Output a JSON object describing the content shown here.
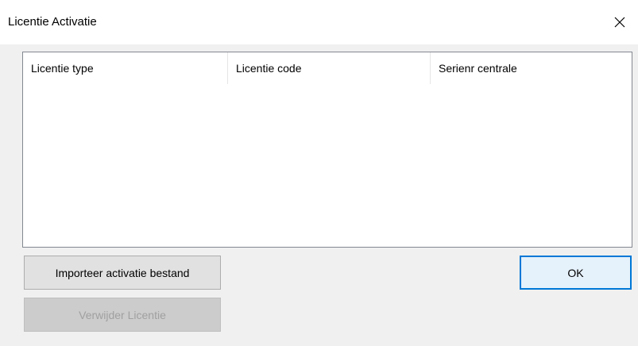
{
  "window": {
    "title": "Licentie Activatie",
    "close_icon": "close-icon"
  },
  "list": {
    "columns": [
      "Licentie type",
      "Licentie code",
      "Serienr centrale"
    ],
    "rows": []
  },
  "buttons": {
    "import_label": "Importeer activatie bestand",
    "delete_label": "Verwijder Licentie",
    "delete_enabled": false,
    "ok_label": "OK"
  },
  "colors": {
    "accent": "#0078d7",
    "window_bg": "#f0f0f0",
    "titlebar_bg": "#ffffff"
  }
}
